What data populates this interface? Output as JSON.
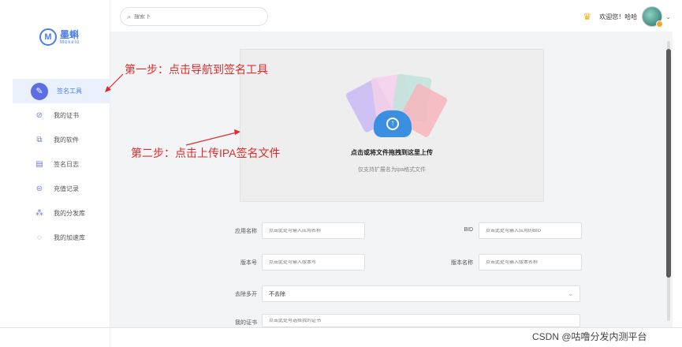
{
  "brand": {
    "logo_cn": "墨蝌",
    "logo_en": "Mokelo"
  },
  "sidebar": {
    "items": [
      {
        "label": "签名工具",
        "icon": "pen-icon",
        "active": true
      },
      {
        "label": "我的证书",
        "icon": "certificate-icon",
        "active": false
      },
      {
        "label": "我的软件",
        "icon": "software-icon",
        "active": false
      },
      {
        "label": "签名日志",
        "icon": "log-icon",
        "active": false
      },
      {
        "label": "充值记录",
        "icon": "recharge-icon",
        "active": false
      },
      {
        "label": "我的分发库",
        "icon": "distribution-icon",
        "active": false
      },
      {
        "label": "我的加速库",
        "icon": "accelerate-icon",
        "active": false
      }
    ]
  },
  "header": {
    "search_placeholder": "搜索下",
    "welcome": "欢迎您！哈哈"
  },
  "upload": {
    "title": "点击或将文件拖拽到这里上传",
    "subtitle": "仅支持扩展名为ipa格式文件"
  },
  "form": {
    "app_name": {
      "label": "应用名称",
      "placeholder": "点击此处可输入应用名称"
    },
    "bid": {
      "label": "BID",
      "placeholder": "点击此处可输入应用的BID"
    },
    "version": {
      "label": "版本号",
      "placeholder": "点击此处可输入版本号"
    },
    "version_name": {
      "label": "版本名称",
      "placeholder": "点击此处可输入版本名称"
    },
    "remove_lock": {
      "label": "去除多开",
      "value": "不去除"
    },
    "cert": {
      "label": "我的证书",
      "placeholder": "点击此处可选择我的证书"
    }
  },
  "annotations": {
    "step1": "第一步：点击导航到签名工具",
    "step2": "第二步：点击上传IPA签名文件"
  },
  "watermark": "CSDN @咕噜分发内测平台",
  "colors": {
    "accent": "#4a7fe6",
    "annotation": "#e12b2b",
    "active_bg": "#eaf1fd"
  }
}
